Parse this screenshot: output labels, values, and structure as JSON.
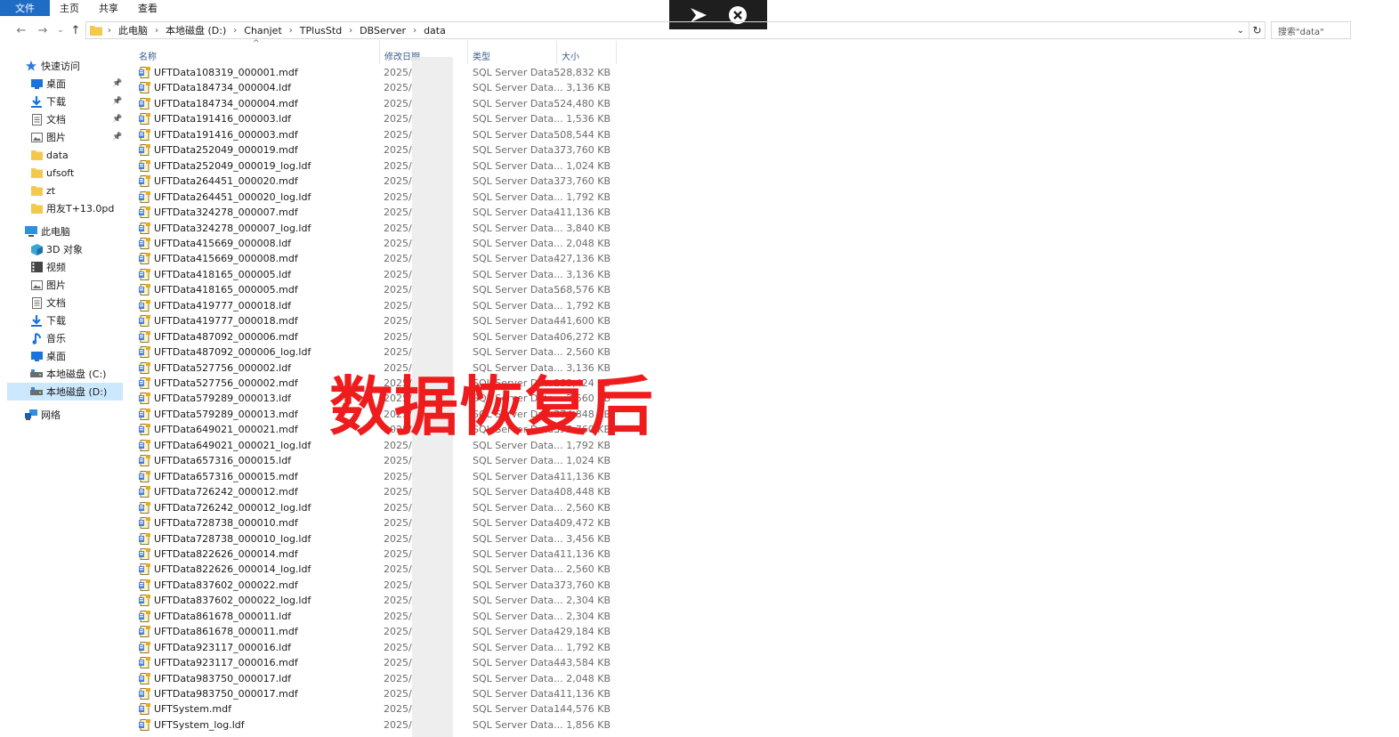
{
  "ribbon": {
    "tabs": [
      {
        "label": "文件"
      },
      {
        "label": "主页"
      },
      {
        "label": "共享"
      },
      {
        "label": "查看"
      }
    ]
  },
  "address": {
    "crumbs": [
      "此电脑",
      "本地磁盘 (D:)",
      "Chanjet",
      "TPlusStd",
      "DBServer",
      "data"
    ],
    "search_placeholder": "搜索\"data\""
  },
  "sidebar": {
    "items": [
      {
        "label": "快速访问",
        "icon": "star-icon"
      },
      {
        "label": "桌面",
        "icon": "desktop-icon",
        "pinned": true
      },
      {
        "label": "下载",
        "icon": "download-icon",
        "pinned": true
      },
      {
        "label": "文档",
        "icon": "document-icon",
        "pinned": true
      },
      {
        "label": "图片",
        "icon": "picture-icon",
        "pinned": true
      },
      {
        "label": "data",
        "icon": "folder-icon"
      },
      {
        "label": "ufsoft",
        "icon": "folder-icon"
      },
      {
        "label": "zt",
        "icon": "folder-icon"
      },
      {
        "label": "用友T+13.0pd",
        "icon": "folder-icon"
      },
      {
        "label": "此电脑",
        "icon": "computer-icon"
      },
      {
        "label": "3D 对象",
        "icon": "cube-icon"
      },
      {
        "label": "视频",
        "icon": "video-icon"
      },
      {
        "label": "图片",
        "icon": "picture-icon"
      },
      {
        "label": "文档",
        "icon": "document-icon"
      },
      {
        "label": "下载",
        "icon": "download-icon"
      },
      {
        "label": "音乐",
        "icon": "music-icon"
      },
      {
        "label": "桌面",
        "icon": "desktop-icon"
      },
      {
        "label": "本地磁盘 (C:)",
        "icon": "drive-icon"
      },
      {
        "label": "本地磁盘 (D:)",
        "icon": "drive-icon",
        "selected": true
      },
      {
        "label": "网络",
        "icon": "network-icon"
      }
    ]
  },
  "columns": {
    "name": "名称",
    "date": "修改日期",
    "type": "类型",
    "size": "大小"
  },
  "files": [
    {
      "name": "UFTData108319_000001.mdf",
      "date": "2025/",
      "type": "SQL Server Data...",
      "size": "528,832 KB"
    },
    {
      "name": "UFTData184734_000004.ldf",
      "date": "2025/",
      "type": "SQL Server Data...",
      "size": "3,136 KB"
    },
    {
      "name": "UFTData184734_000004.mdf",
      "date": "2025/",
      "type": "SQL Server Data...",
      "size": "524,480 KB"
    },
    {
      "name": "UFTData191416_000003.ldf",
      "date": "2025/",
      "type": "SQL Server Data...",
      "size": "1,536 KB"
    },
    {
      "name": "UFTData191416_000003.mdf",
      "date": "2025/",
      "type": "SQL Server Data...",
      "size": "508,544 KB"
    },
    {
      "name": "UFTData252049_000019.mdf",
      "date": "2025/",
      "type": "SQL Server Data...",
      "size": "373,760 KB"
    },
    {
      "name": "UFTData252049_000019_log.ldf",
      "date": "2025/",
      "type": "SQL Server Data...",
      "size": "1,024 KB"
    },
    {
      "name": "UFTData264451_000020.mdf",
      "date": "2025/",
      "type": "SQL Server Data...",
      "size": "373,760 KB"
    },
    {
      "name": "UFTData264451_000020_log.ldf",
      "date": "2025/",
      "type": "SQL Server Data...",
      "size": "1,792 KB"
    },
    {
      "name": "UFTData324278_000007.mdf",
      "date": "2025/",
      "type": "SQL Server Data...",
      "size": "411,136 KB"
    },
    {
      "name": "UFTData324278_000007_log.ldf",
      "date": "2025/",
      "type": "SQL Server Data...",
      "size": "3,840 KB"
    },
    {
      "name": "UFTData415669_000008.ldf",
      "date": "2025/",
      "type": "SQL Server Data...",
      "size": "2,048 KB"
    },
    {
      "name": "UFTData415669_000008.mdf",
      "date": "2025/",
      "type": "SQL Server Data...",
      "size": "427,136 KB"
    },
    {
      "name": "UFTData418165_000005.ldf",
      "date": "2025/",
      "type": "SQL Server Data...",
      "size": "3,136 KB"
    },
    {
      "name": "UFTData418165_000005.mdf",
      "date": "2025/",
      "type": "SQL Server Data...",
      "size": "568,576 KB"
    },
    {
      "name": "UFTData419777_000018.ldf",
      "date": "2025/",
      "type": "SQL Server Data...",
      "size": "1,792 KB"
    },
    {
      "name": "UFTData419777_000018.mdf",
      "date": "2025/",
      "type": "SQL Server Data...",
      "size": "441,600 KB"
    },
    {
      "name": "UFTData487092_000006.mdf",
      "date": "2025/",
      "type": "SQL Server Data...",
      "size": "406,272 KB"
    },
    {
      "name": "UFTData487092_000006_log.ldf",
      "date": "2025/",
      "type": "SQL Server Data...",
      "size": "2,560 KB"
    },
    {
      "name": "UFTData527756_000002.ldf",
      "date": "2025/",
      "type": "SQL Server Data...",
      "size": "3,136 KB"
    },
    {
      "name": "UFTData527756_000002.mdf",
      "date": "2025/",
      "type": "SQL Server Data...",
      "size": "383,424 KB"
    },
    {
      "name": "UFTData579289_000013.ldf",
      "date": "2025/",
      "type": "SQL Server Data...",
      "size": "2,560 KB"
    },
    {
      "name": "UFTData579289_000013.mdf",
      "date": "2025/",
      "type": "SQL Server Data...",
      "size": "374,848 KB"
    },
    {
      "name": "UFTData649021_000021.mdf",
      "date": "2025/",
      "type": "SQL Server Data...",
      "size": "373,760 KB"
    },
    {
      "name": "UFTData649021_000021_log.ldf",
      "date": "2025/",
      "type": "SQL Server Data...",
      "size": "1,792 KB"
    },
    {
      "name": "UFTData657316_000015.ldf",
      "date": "2025/",
      "type": "SQL Server Data...",
      "size": "1,024 KB"
    },
    {
      "name": "UFTData657316_000015.mdf",
      "date": "2025/",
      "type": "SQL Server Data...",
      "size": "411,136 KB"
    },
    {
      "name": "UFTData726242_000012.mdf",
      "date": "2025/",
      "type": "SQL Server Data...",
      "size": "408,448 KB"
    },
    {
      "name": "UFTData726242_000012_log.ldf",
      "date": "2025/",
      "type": "SQL Server Data...",
      "size": "2,560 KB"
    },
    {
      "name": "UFTData728738_000010.mdf",
      "date": "2025/",
      "type": "SQL Server Data...",
      "size": "409,472 KB"
    },
    {
      "name": "UFTData728738_000010_log.ldf",
      "date": "2025/",
      "type": "SQL Server Data...",
      "size": "3,456 KB"
    },
    {
      "name": "UFTData822626_000014.mdf",
      "date": "2025/",
      "type": "SQL Server Data...",
      "size": "411,136 KB"
    },
    {
      "name": "UFTData822626_000014_log.ldf",
      "date": "2025/",
      "type": "SQL Server Data...",
      "size": "2,560 KB"
    },
    {
      "name": "UFTData837602_000022.mdf",
      "date": "2025/",
      "type": "SQL Server Data...",
      "size": "373,760 KB"
    },
    {
      "name": "UFTData837602_000022_log.ldf",
      "date": "2025/",
      "type": "SQL Server Data...",
      "size": "2,304 KB"
    },
    {
      "name": "UFTData861678_000011.ldf",
      "date": "2025/",
      "type": "SQL Server Data...",
      "size": "2,304 KB"
    },
    {
      "name": "UFTData861678_000011.mdf",
      "date": "2025/",
      "type": "SQL Server Data...",
      "size": "429,184 KB"
    },
    {
      "name": "UFTData923117_000016.ldf",
      "date": "2025/",
      "type": "SQL Server Data...",
      "size": "1,792 KB"
    },
    {
      "name": "UFTData923117_000016.mdf",
      "date": "2025/",
      "type": "SQL Server Data...",
      "size": "443,584 KB"
    },
    {
      "name": "UFTData983750_000017.ldf",
      "date": "2025/",
      "type": "SQL Server Data...",
      "size": "2,048 KB"
    },
    {
      "name": "UFTData983750_000017.mdf",
      "date": "2025/",
      "type": "SQL Server Data...",
      "size": "411,136 KB"
    },
    {
      "name": "UFTSystem.mdf",
      "date": "2025/",
      "type": "SQL Server Data...",
      "size": "144,576 KB"
    },
    {
      "name": "UFTSystem_log.ldf",
      "date": "2025/",
      "type": "SQL Server Data...",
      "size": "1,856 KB"
    }
  ],
  "watermark": "数据恢复后",
  "colors": {
    "accent": "#1f6cc5",
    "selection": "#cce8ff",
    "watermark": "#ee1c1c",
    "folder": "#f2c94c"
  }
}
